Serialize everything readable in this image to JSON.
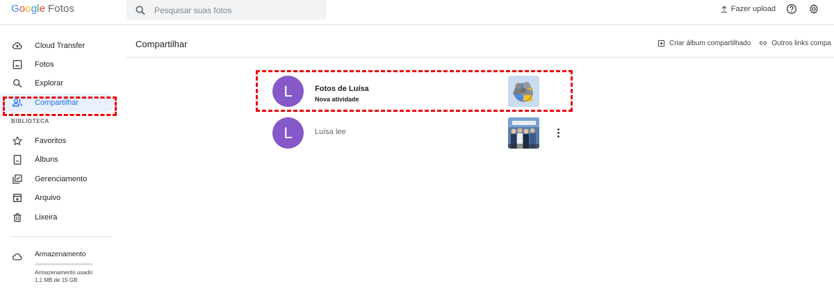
{
  "app": {
    "logo_google": "Google",
    "logo_product": "Fotos"
  },
  "search": {
    "placeholder": "Pesquisar suas fotos",
    "icon": "search-icon"
  },
  "header": {
    "upload_label": "Fazer upload",
    "upload_icon": "upload-icon",
    "help_icon": "help-icon",
    "settings_icon": "gear-icon"
  },
  "sidebar": {
    "items": [
      {
        "label": "Cloud Transfer",
        "icon": "cloud-transfer-icon"
      },
      {
        "label": "Fotos",
        "icon": "photo-icon"
      },
      {
        "label": "Explorar",
        "icon": "search-icon"
      },
      {
        "label": "Compartilhar",
        "icon": "people-icon",
        "active": true
      }
    ],
    "library_title": "BIBLIOTECA",
    "library_items": [
      {
        "label": "Favoritos",
        "icon": "star-icon"
      },
      {
        "label": "Álbuns",
        "icon": "album-icon"
      },
      {
        "label": "Gerenciamento",
        "icon": "manage-icon"
      },
      {
        "label": "Arquivo",
        "icon": "archive-icon"
      },
      {
        "label": "Lixeira",
        "icon": "trash-icon"
      }
    ],
    "storage": {
      "title": "Armazenamento",
      "text": "Armazenamento usado: 1,1 MB de 15 GB",
      "used_fraction": 0.0001,
      "icon": "cloud-icon"
    }
  },
  "main": {
    "title": "Compartilhar",
    "actions": [
      {
        "label": "Criar álbum compartilhado",
        "icon": "add-box-icon"
      },
      {
        "label": "Outros links compa",
        "icon": "link-icon"
      }
    ],
    "shares": [
      {
        "avatar_letter": "L",
        "title": "Fotos de Luísa",
        "subtitle": "Nova atividade",
        "thumb": "people-photo-thumbnail",
        "highlighted": true
      },
      {
        "avatar_letter": "L",
        "name": "Luísa lee",
        "thumb": "group-photo-thumbnail",
        "has_more_menu": true
      }
    ]
  },
  "colors": {
    "accent": "#1a73e8",
    "avatar": "#8659c9",
    "highlight_dash": "#e8000b",
    "active_bg": "#e8f0fe"
  }
}
